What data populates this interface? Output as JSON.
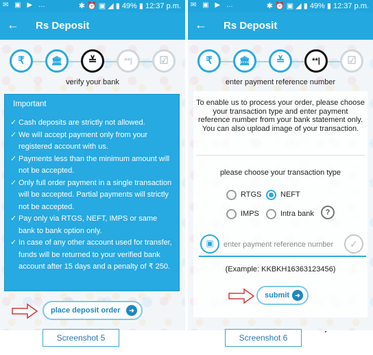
{
  "status_bar": {
    "battery": "49%",
    "time": "12:37 p.m."
  },
  "screens": [
    {
      "title": "Rs Deposit",
      "steps": [
        "₹",
        "🏛",
        "≚",
        "**|",
        "☑"
      ],
      "step_caption": "verify your bank",
      "notice": {
        "heading": "Important",
        "items": [
          "Cash deposits are strictly not allowed.",
          "We will accept payment only from your registered account with us.",
          "Payments less than the minimum amount will not be accepted.",
          "Only full order payment in a single transaction will be accepted. Partial payments will strictly not be accepted.",
          "Pay only via RTGS, NEFT, IMPS or same bank to bank option only.",
          "In case of any other account used for transfer, funds will be returned to your verified bank account after 15 days and a penalty of ₹ 250."
        ]
      },
      "button_label": "place deposit order",
      "caption": "Screenshot 5"
    },
    {
      "title": "Rs Deposit",
      "steps": [
        "₹",
        "🏛",
        "≚",
        "**|",
        "☑"
      ],
      "step_caption": "enter payment reference number",
      "intro": "To enable us to process your order, please choose your transaction type and enter payment reference number from your bank statement only. You can also upload image of your transaction.",
      "choose_label": "please choose your transaction type",
      "transaction_types": [
        "RTGS",
        "NEFT",
        "IMPS",
        "Intra bank"
      ],
      "selected_type": "NEFT",
      "reference_placeholder": "enter payment reference number",
      "example": "(Example: KKBKH16363123456)",
      "button_label": "submit",
      "caption": "Screenshot 6"
    }
  ],
  "colors": {
    "primary": "#24a8e0",
    "notice_bg": "#27a9e1",
    "button_text": "#1e87c2"
  }
}
